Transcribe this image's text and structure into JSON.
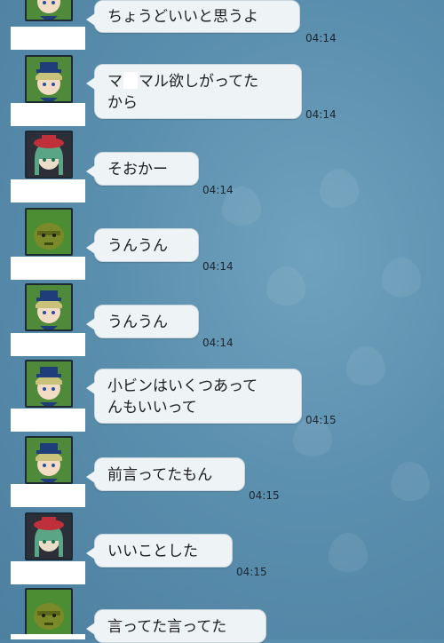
{
  "messages": [
    {
      "speaker": "boy",
      "text": "ちょうどいいと思うよ",
      "time": "04:14"
    },
    {
      "speaker": "boy",
      "text_before": "マ",
      "text_after": "マル欲しがってた\nから",
      "time": "04:14"
    },
    {
      "speaker": "girl",
      "text": "そおかー",
      "time": "04:14"
    },
    {
      "speaker": "ogre",
      "text": "うんうん",
      "time": "04:14"
    },
    {
      "speaker": "boy",
      "text": "うんうん",
      "time": "04:14"
    },
    {
      "speaker": "boy",
      "text": "小ビンはいくつあって\nんもいいって",
      "time": "04:15"
    },
    {
      "speaker": "boy",
      "text": "前言ってたもん",
      "time": "04:15"
    },
    {
      "speaker": "girl",
      "text": "いいことした",
      "time": "04:15"
    },
    {
      "speaker": "ogre",
      "text": "言ってた言ってた",
      "time": ""
    }
  ],
  "colors": {
    "background": "#5b8fae",
    "bubble": "#eef3f6",
    "timestamp": "#1b2530"
  }
}
